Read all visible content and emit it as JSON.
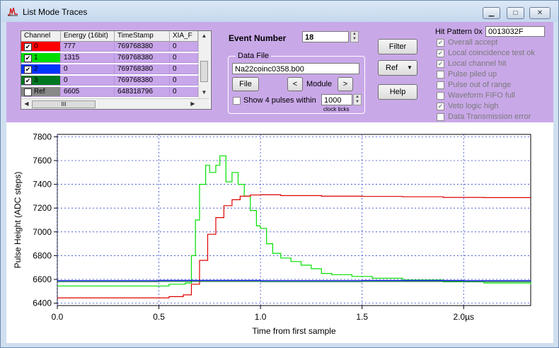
{
  "window": {
    "title": "List Mode Traces"
  },
  "table": {
    "headers": [
      "Channel",
      "Energy (16bit)",
      "TimeStamp",
      "XIA_F"
    ],
    "rows": [
      {
        "channel": "0",
        "energy": "777",
        "timestamp": "769768380",
        "xia": "0",
        "color": "#ff0000",
        "checked": "✔"
      },
      {
        "channel": "1",
        "energy": "1315",
        "timestamp": "769768380",
        "xia": "0",
        "color": "#00dd00",
        "checked": "✔"
      },
      {
        "channel": "2",
        "energy": "0",
        "timestamp": "769768380",
        "xia": "0",
        "color": "#0033ff",
        "checked": "✔"
      },
      {
        "channel": "3",
        "energy": "0",
        "timestamp": "769768380",
        "xia": "0",
        "color": "#007722",
        "checked": "✔"
      },
      {
        "channel": "Ref",
        "energy": "6605",
        "timestamp": "648318796",
        "xia": "0",
        "color": "#888888",
        "checked": ""
      }
    ],
    "scroll_h_label": "III"
  },
  "event": {
    "label": "Event Number",
    "value": "18"
  },
  "data_file": {
    "group_label": "Data File",
    "filename": "Na22coinc0358.b00",
    "file_button": "File",
    "prev": "<",
    "module_label": "Module",
    "next": ">",
    "show_pulses_label": "Show 4 pulses within",
    "pulses_value": "1000",
    "clock_ticks": "clock ticks"
  },
  "buttons": {
    "filter": "Filter",
    "ref": "Ref",
    "help": "Help"
  },
  "hit_pattern": {
    "label": "Hit Pattern 0x",
    "value": "0013032F",
    "flags": [
      {
        "label": "Overall accept",
        "checked": "✔"
      },
      {
        "label": "Local coincidence test ok",
        "checked": "✔"
      },
      {
        "label": "Local channel hit",
        "checked": "✔"
      },
      {
        "label": "Pulse piled up",
        "checked": ""
      },
      {
        "label": "Pulse out of range",
        "checked": ""
      },
      {
        "label": "Waveform FIFO full",
        "checked": ""
      },
      {
        "label": "Veto logic high",
        "checked": "✔"
      },
      {
        "label": "Data Transmission error",
        "checked": ""
      }
    ]
  },
  "chart_data": {
    "type": "line",
    "xlabel": "Time from first sample",
    "ylabel": "Pulse Height (ADC steps)",
    "xlim": [
      0,
      2.33
    ],
    "ylim": [
      6380,
      7820
    ],
    "xticks": [
      {
        "v": 0,
        "label": "0.0"
      },
      {
        "v": 0.5,
        "label": "0.5"
      },
      {
        "v": 1.0,
        "label": "1.0"
      },
      {
        "v": 1.5,
        "label": "1.5"
      },
      {
        "v": 2.0,
        "label": "2.0µs"
      }
    ],
    "yticks": [
      6400,
      6600,
      6800,
      7000,
      7200,
      7400,
      7600,
      7800
    ],
    "grid": true,
    "series": [
      {
        "color": "#00e000",
        "points": [
          [
            0,
            6545
          ],
          [
            0.55,
            6560
          ],
          [
            0.63,
            6570
          ],
          [
            0.66,
            6800
          ],
          [
            0.68,
            7100
          ],
          [
            0.7,
            7400
          ],
          [
            0.73,
            7560
          ],
          [
            0.75,
            7500
          ],
          [
            0.78,
            7560
          ],
          [
            0.8,
            7640
          ],
          [
            0.83,
            7420
          ],
          [
            0.86,
            7500
          ],
          [
            0.89,
            7400
          ],
          [
            0.92,
            7300
          ],
          [
            0.95,
            7180
          ],
          [
            0.98,
            7050
          ],
          [
            1.0,
            7030
          ],
          [
            1.03,
            6900
          ],
          [
            1.06,
            6820
          ],
          [
            1.1,
            6780
          ],
          [
            1.15,
            6750
          ],
          [
            1.2,
            6720
          ],
          [
            1.25,
            6690
          ],
          [
            1.3,
            6650
          ],
          [
            1.35,
            6640
          ],
          [
            1.45,
            6625
          ],
          [
            1.55,
            6610
          ],
          [
            1.7,
            6595
          ],
          [
            1.9,
            6580
          ],
          [
            2.1,
            6570
          ],
          [
            2.33,
            6560
          ]
        ]
      },
      {
        "color": "#dd0000",
        "points": [
          [
            0,
            6445
          ],
          [
            0.55,
            6455
          ],
          [
            0.62,
            6470
          ],
          [
            0.66,
            6560
          ],
          [
            0.7,
            6760
          ],
          [
            0.74,
            6980
          ],
          [
            0.78,
            7120
          ],
          [
            0.82,
            7220
          ],
          [
            0.86,
            7270
          ],
          [
            0.9,
            7300
          ],
          [
            0.95,
            7310
          ],
          [
            1.0,
            7312
          ],
          [
            1.1,
            7305
          ],
          [
            1.3,
            7300
          ],
          [
            1.5,
            7298
          ],
          [
            1.7,
            7295
          ],
          [
            1.9,
            7290
          ],
          [
            2.1,
            7288
          ],
          [
            2.33,
            7290
          ]
        ]
      },
      {
        "color": "#1a1aff",
        "points": [
          [
            0,
            6590
          ],
          [
            0.5,
            6592
          ],
          [
            1.0,
            6590
          ],
          [
            1.5,
            6591
          ],
          [
            2.0,
            6590
          ],
          [
            2.33,
            6591
          ]
        ]
      },
      {
        "color": "#006633",
        "points": [
          [
            0,
            6582
          ],
          [
            0.5,
            6583
          ],
          [
            1.0,
            6582
          ],
          [
            1.5,
            6583
          ],
          [
            2.0,
            6582
          ],
          [
            2.33,
            6583
          ]
        ]
      }
    ]
  }
}
